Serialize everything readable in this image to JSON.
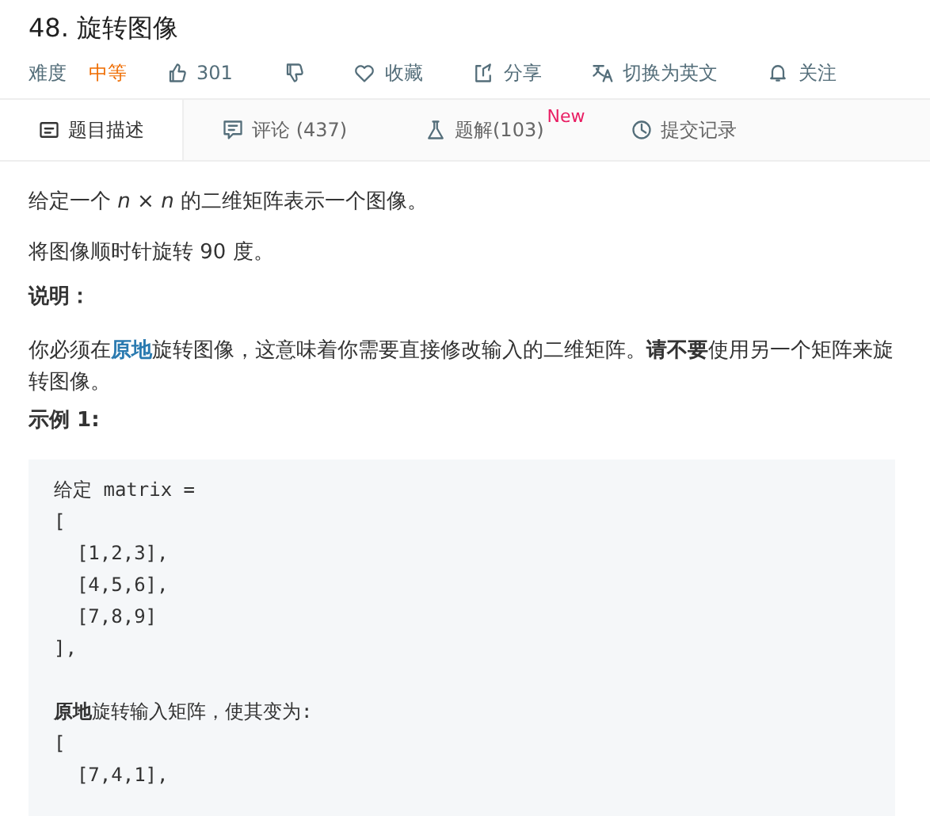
{
  "title": "48. 旋转图像",
  "meta": {
    "difficulty_label": "难度",
    "difficulty": "中等",
    "likes": "301",
    "actions": [
      {
        "kind": "favorite",
        "label": "收藏"
      },
      {
        "kind": "share",
        "label": "分享"
      },
      {
        "kind": "translate",
        "label": "切换为英文"
      },
      {
        "kind": "follow",
        "label": "关注"
      }
    ]
  },
  "tabs": [
    {
      "kind": "description",
      "label": "题目描述",
      "selected": true
    },
    {
      "kind": "comments",
      "label": "评论 (437)",
      "selected": false
    },
    {
      "kind": "solutions",
      "label": "题解(103)",
      "badge": "New",
      "selected": false
    },
    {
      "kind": "submissions",
      "label": "提交记录",
      "selected": false
    }
  ],
  "content": [
    {
      "kind": "text",
      "segments": [
        {
          "text": "给定一个 *n* × *n* 的二维矩阵表示一个图像。"
        }
      ]
    },
    {
      "kind": "text",
      "segments": [
        {
          "text": "将图像顺时针旋转 90 度。"
        }
      ]
    },
    {
      "kind": "heading",
      "text": "说明："
    },
    {
      "kind": "text",
      "segments": [
        {
          "text": "你必须在"
        },
        {
          "text": "原地",
          "link": true
        },
        {
          "text": "旋转图像，这意味着你需要直接修改输入的二维矩阵。**请不要**使用另一个矩阵来旋转图像。"
        }
      ]
    },
    {
      "kind": "heading",
      "text": "示例 1:"
    }
  ],
  "code": [
    {
      "text": "给定 matrix ="
    },
    {
      "text": "["
    },
    {
      "text": "  [1,2,3],"
    },
    {
      "text": "  [4,5,6],"
    },
    {
      "text": "  [7,8,9]"
    },
    {
      "text": "],"
    },
    {
      "text": "**原地**旋转输入矩阵，使其变为:",
      "gap_before": true
    },
    {
      "text": "["
    },
    {
      "text": "  [7,4,1],"
    }
  ]
}
